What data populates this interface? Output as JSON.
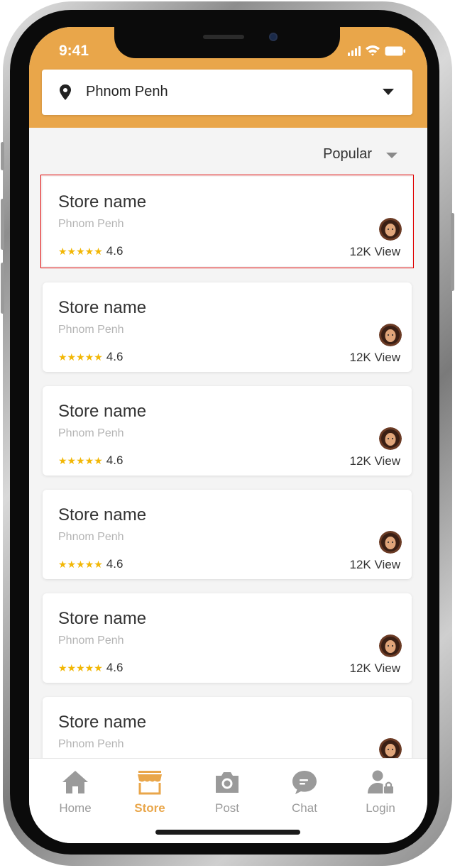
{
  "status_bar": {
    "time": "9:41"
  },
  "location": {
    "value": "Phnom Penh",
    "icon": "location-pin-icon"
  },
  "sort": {
    "label": "Popular"
  },
  "stores": [
    {
      "name": "Store name",
      "city": "Phnom Penh",
      "stars": "★★★★★",
      "rating": "4.6",
      "views": "12K View",
      "highlighted": true
    },
    {
      "name": "Store name",
      "city": "Phnom Penh",
      "stars": "★★★★★",
      "rating": "4.6",
      "views": "12K View"
    },
    {
      "name": "Store name",
      "city": "Phnom Penh",
      "stars": "★★★★★",
      "rating": "4.6",
      "views": "12K View"
    },
    {
      "name": "Store name",
      "city": "Phnom Penh",
      "stars": "★★★★★",
      "rating": "4.6",
      "views": "12K View"
    },
    {
      "name": "Store name",
      "city": "Phnom Penh",
      "stars": "★★★★★",
      "rating": "4.6",
      "views": "12K View"
    },
    {
      "name": "Store name",
      "city": "Phnom Penh"
    }
  ],
  "nav": {
    "items": [
      {
        "label": "Home",
        "icon": "home-icon"
      },
      {
        "label": "Store",
        "icon": "store-icon",
        "active": true
      },
      {
        "label": "Post",
        "icon": "camera-icon"
      },
      {
        "label": "Chat",
        "icon": "chat-icon"
      },
      {
        "label": "Login",
        "icon": "user-lock-icon"
      }
    ]
  },
  "colors": {
    "header": "#e9a64a",
    "active_nav": "#e9a64a",
    "inactive_nav": "#9a9a9a",
    "star": "#f2b705",
    "highlight_border": "#e00000"
  }
}
